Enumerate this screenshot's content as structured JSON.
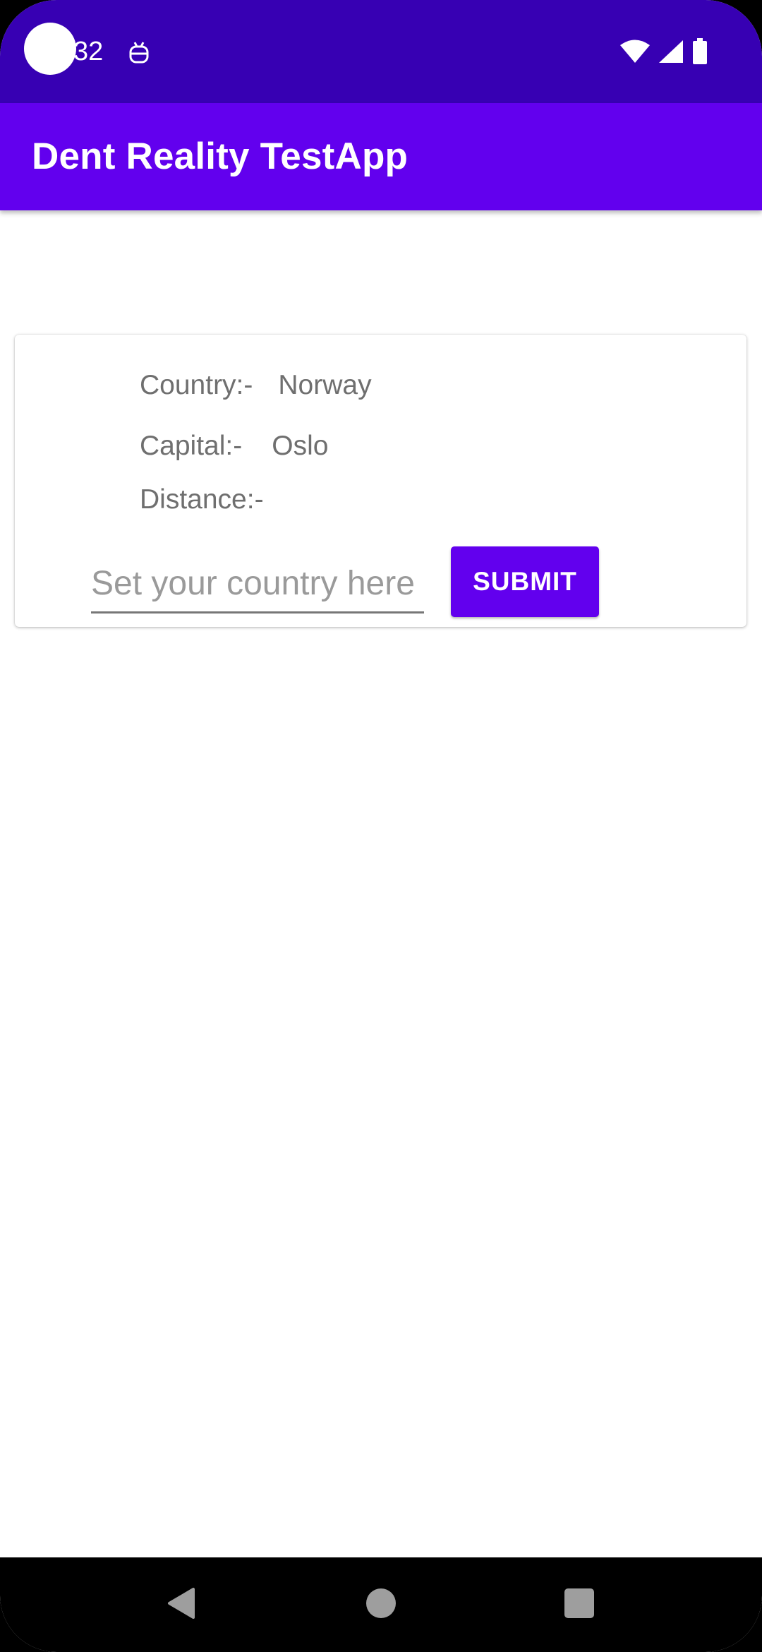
{
  "status_bar": {
    "time": "32",
    "icons": [
      "notification-icon",
      "wifi-icon",
      "signal-icon",
      "battery-icon"
    ]
  },
  "app_bar": {
    "title": "Dent Reality TestApp"
  },
  "card": {
    "country_label": "Country:-",
    "country_value": "Norway",
    "capital_label": "Capital:-",
    "capital_value": "Oslo",
    "distance_label": "Distance:-",
    "distance_value": "",
    "input": {
      "placeholder": "Set your country here",
      "value": ""
    },
    "submit_label": "SUBMIT"
  },
  "nav_bar": {
    "icons": [
      "back-icon",
      "home-icon",
      "recents-icon"
    ]
  },
  "colors": {
    "status_bar": "#3700B3",
    "primary": "#6200EE",
    "text_secondary": "#6f6f6f",
    "background": "#ffffff"
  }
}
